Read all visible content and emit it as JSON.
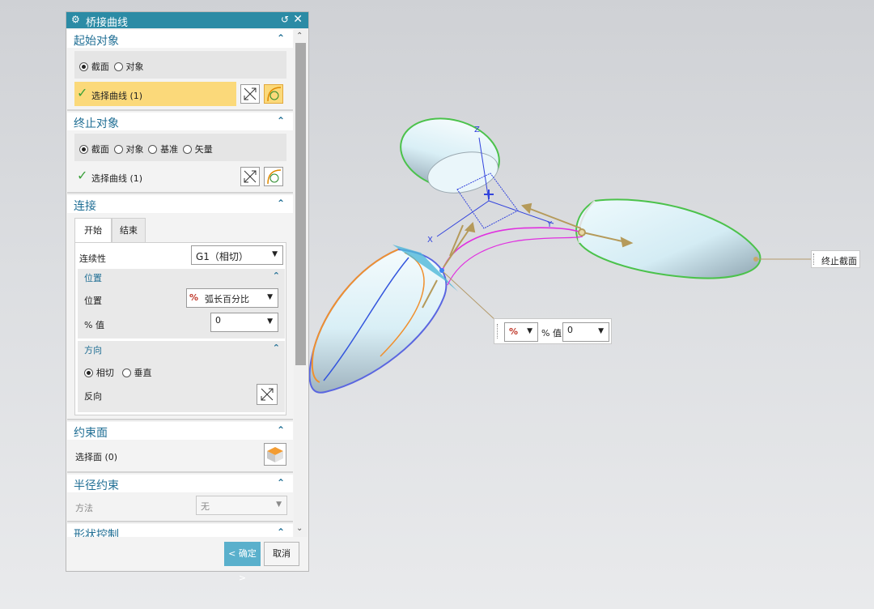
{
  "dialog": {
    "title": "桥接曲线",
    "icons": {
      "gear": "gear-icon",
      "reset": "reset-icon",
      "close": "close-icon"
    },
    "start": {
      "title": "起始对象",
      "options": [
        "截面",
        "对象"
      ],
      "selected": "截面",
      "select_label": "选择曲线 (1)"
    },
    "end": {
      "title": "终止对象",
      "options": [
        "截面",
        "对象",
        "基准",
        "矢量"
      ],
      "selected": "截面",
      "select_label": "选择曲线 (1)"
    },
    "connect": {
      "title": "连接",
      "tabs": [
        "开始",
        "结束"
      ],
      "active_tab": "开始",
      "continuity_label": "连续性",
      "continuity_value": "G1（相切）",
      "position_group": {
        "title": "位置",
        "position_label": "位置",
        "position_icon_text": "%",
        "position_value": "弧长百分比",
        "percent_label": "% 值",
        "percent_value": "0"
      },
      "direction_group": {
        "title": "方向",
        "options": [
          "相切",
          "垂直"
        ],
        "selected": "相切",
        "reverse_label": "反向"
      }
    },
    "constraint_face": {
      "title": "约束面",
      "select_label": "选择面 (0)"
    },
    "radius": {
      "title": "半径约束",
      "method_label": "方法",
      "method_value": "无"
    },
    "shape": {
      "title": "形状控制"
    },
    "ok_label": "< 确定 >",
    "cancel_label": "取消"
  },
  "viewport": {
    "end_section_label": "终止截面",
    "float_percent_label": "% 值",
    "float_percent_value": "0",
    "float_icon_text": "%",
    "axes": {
      "z": "Z",
      "y": "Y",
      "x": "X"
    }
  },
  "colors": {
    "title_bar": "#2b8ba5",
    "section_title": "#1f6e94",
    "highlight": "#fbd97a",
    "ok_button": "#5ab0cc",
    "bridge_curve": "#e030e0"
  }
}
